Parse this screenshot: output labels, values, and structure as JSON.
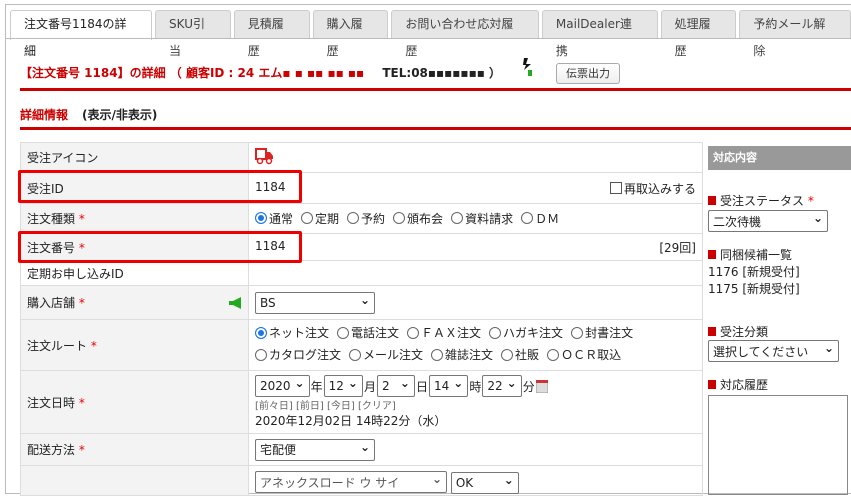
{
  "tabs": [
    "注文番号1184の詳細",
    "SKU引当",
    "見積履歴",
    "購入履歴",
    "お問い合わせ応対履歴",
    "MailDealer連携",
    "処理履歴",
    "予約メール解除"
  ],
  "header": {
    "title": "【注文番号 1184】の詳細",
    "customer": "（ 顧客ID : 24 エム▪ ▪ ▪▪ ▪▪ ▪▪",
    "tel": "TEL:08▪▪▪▪▪▪▪ ）",
    "print_button": "伝票出力"
  },
  "section": {
    "title": "詳細情報",
    "toggle": "(表示/非表示)"
  },
  "rows": {
    "icon_label": "受注アイコン",
    "id_label": "受注ID",
    "id_value": "1184",
    "reimport": "再取込みする",
    "type_label": "注文種類",
    "type_options": [
      "通常",
      "定期",
      "予約",
      "頒布会",
      "資料請求",
      "ＤＭ"
    ],
    "number_label": "注文番号",
    "number_value": "1184",
    "count": "[29回]",
    "sub_label": "定期お申し込みID",
    "store_label": "購入店舗",
    "store_value": "BS",
    "route_label": "注文ルート",
    "route_options": [
      "ネット注文",
      "電話注文",
      "ＦＡＸ注文",
      "ハガキ注文",
      "封書注文",
      "カタログ注文",
      "メール注文",
      "雑誌注文",
      "社販",
      "ＯＣＲ取込"
    ],
    "date_label": "注文日時",
    "year": "2020",
    "year_u": "年",
    "month": "12",
    "month_u": "月",
    "day": "2",
    "day_u": "日",
    "hour": "14",
    "hour_u": "時",
    "min": "22",
    "min_u": "分",
    "date_links": [
      "[前々日]",
      "[前日]",
      "[今日]",
      "[クリア]"
    ],
    "date_text": "2020年12月02日 14時22分（水）",
    "ship_label": "配送方法",
    "ship_value": "宅配便",
    "next_value1": "アネックスロード ウ サイ",
    "next_value2": "OK"
  },
  "right": {
    "header": "対応内容",
    "status_label": "受注ステータス",
    "status_value": "二次待機",
    "bundle_label": "同梱候補一覧",
    "bundle": [
      "1176 [新規受付]",
      "1175 [新規受付]"
    ],
    "class_label": "受注分類",
    "class_value": "選択してください",
    "history_label": "対応履歴"
  },
  "required_mark": "*",
  "colors": {
    "accent": "#cc0000",
    "highlight": "#ee0000"
  }
}
